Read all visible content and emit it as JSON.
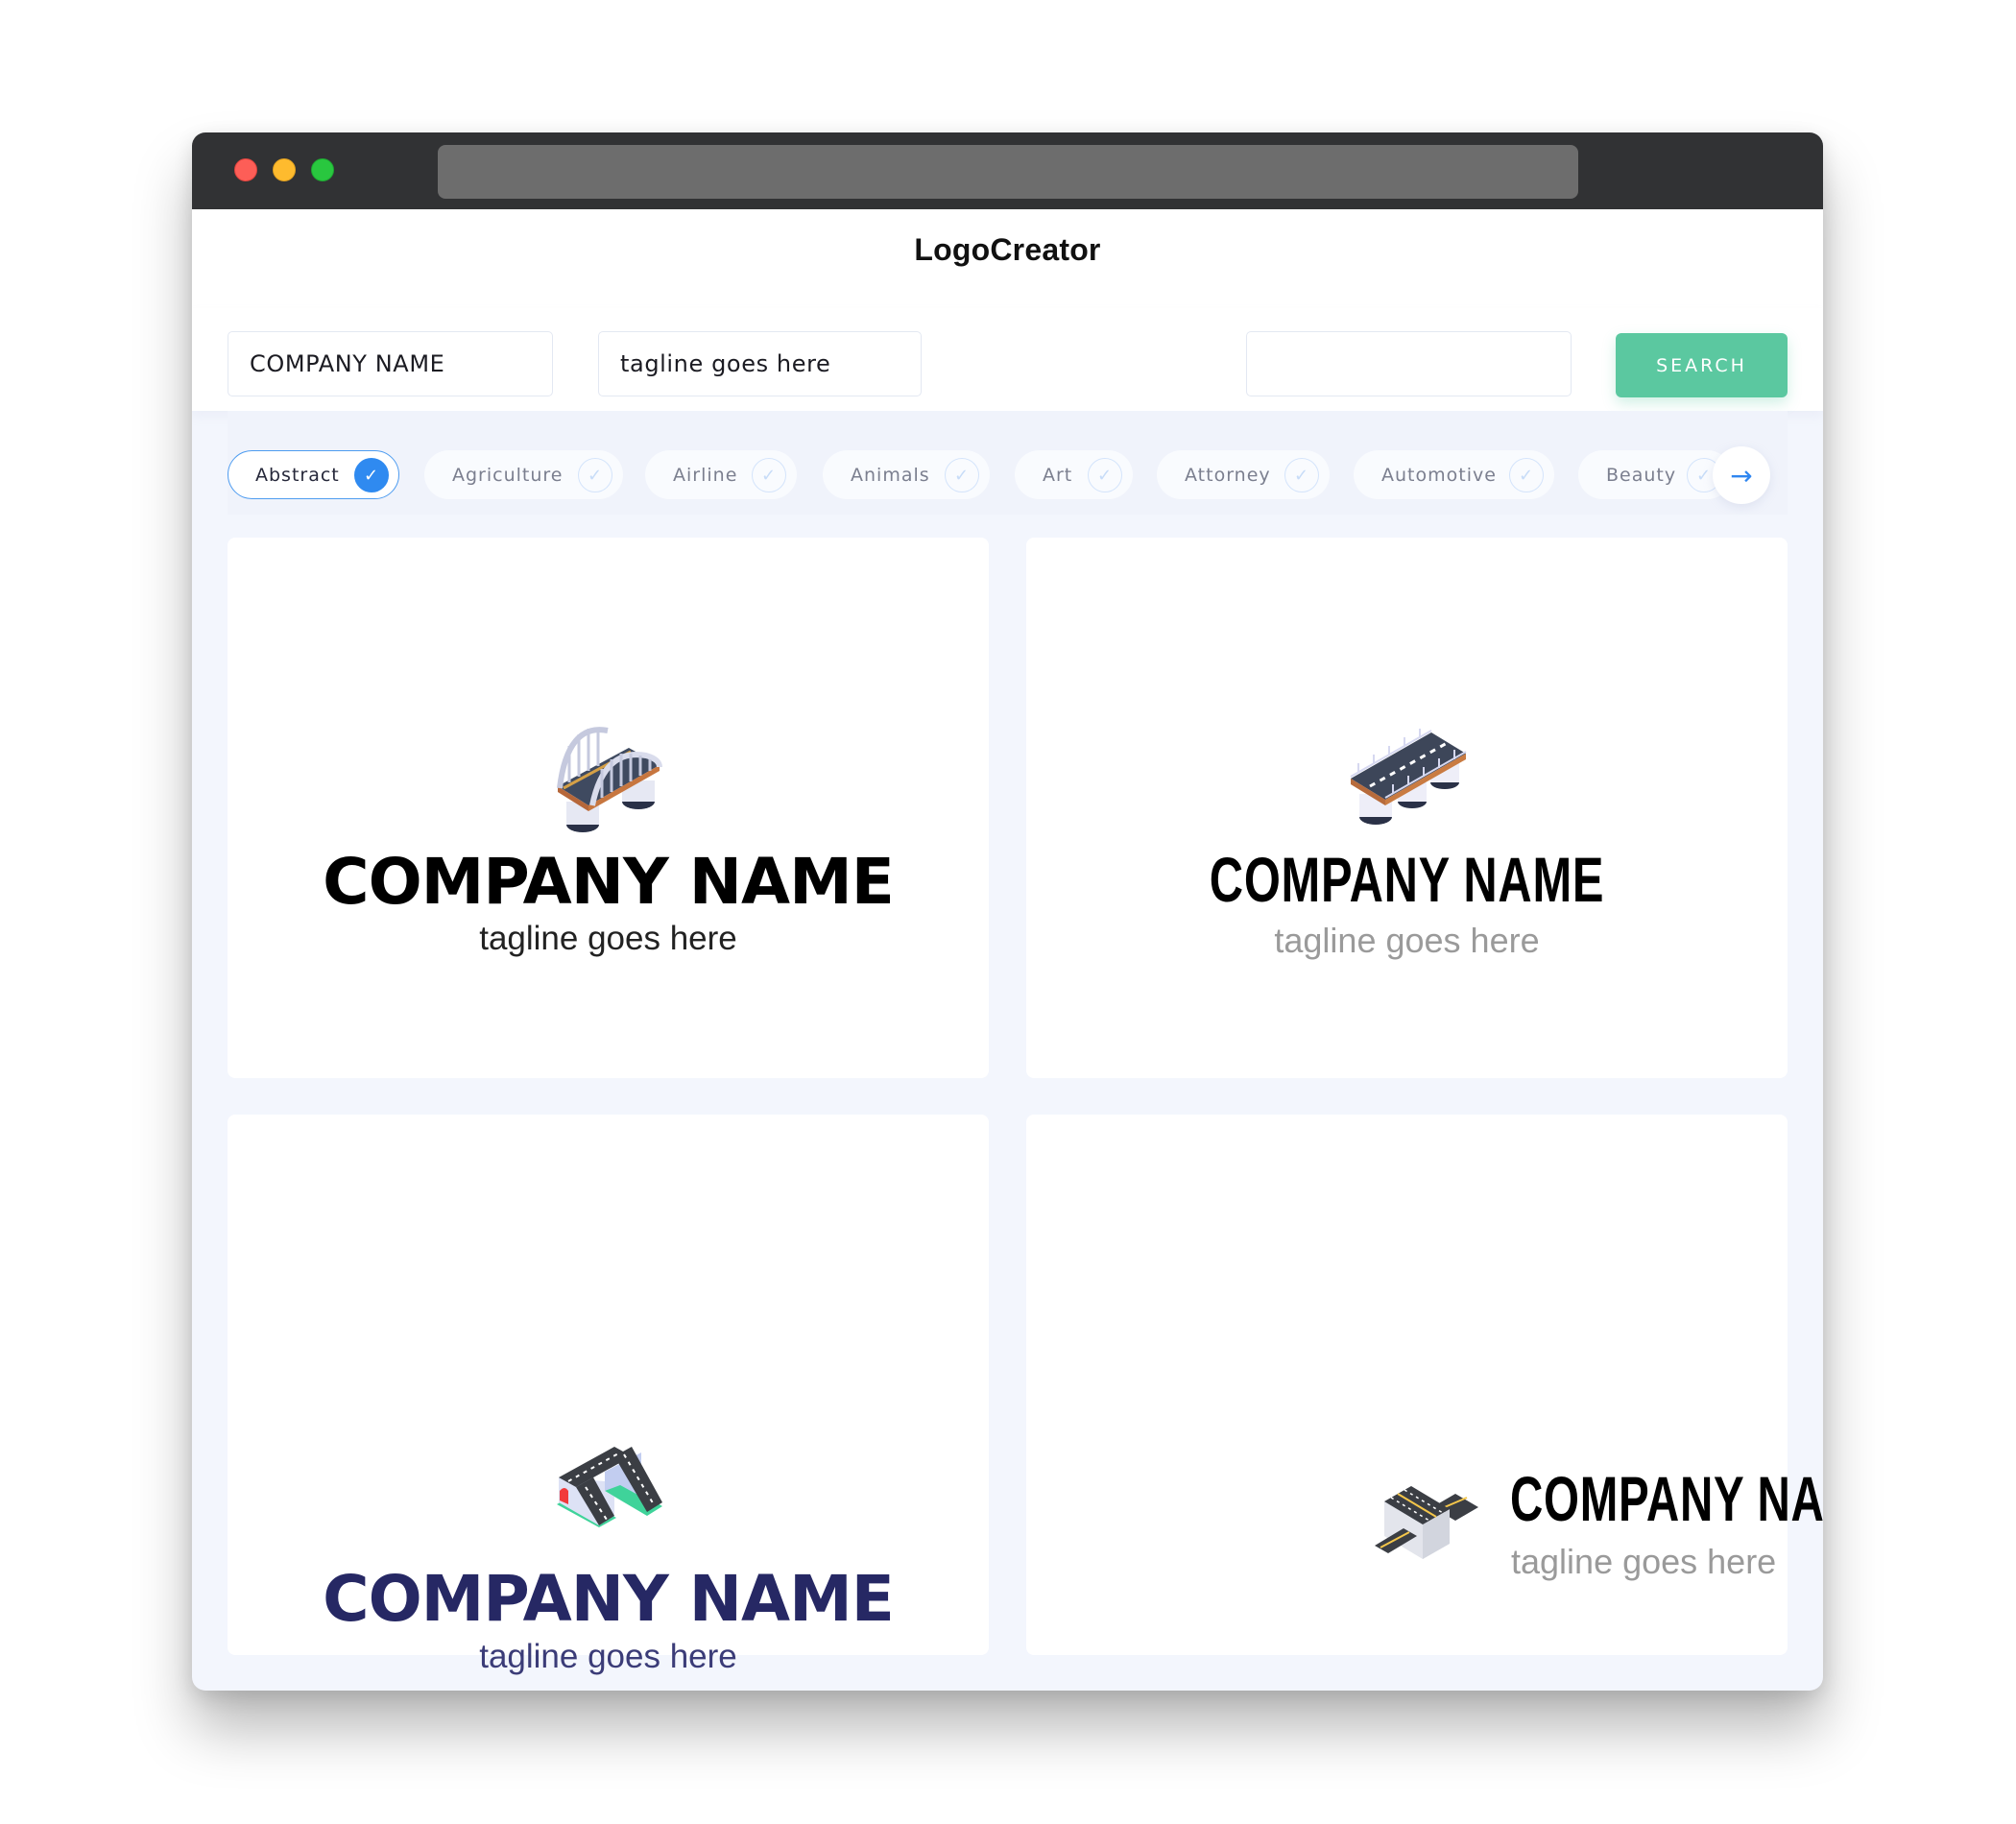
{
  "browser": {
    "controls": [
      "close",
      "minimize",
      "maximize"
    ]
  },
  "header": {
    "brand": "LogoCreator"
  },
  "search": {
    "company_value": "COMPANY NAME",
    "tagline_value": "tagline goes here",
    "extra_value": "",
    "button_label": "SEARCH"
  },
  "filters": {
    "items": [
      {
        "label": "Abstract",
        "selected": true
      },
      {
        "label": "Agriculture",
        "selected": false
      },
      {
        "label": "Airline",
        "selected": false
      },
      {
        "label": "Animals",
        "selected": false
      },
      {
        "label": "Art",
        "selected": false
      },
      {
        "label": "Attorney",
        "selected": false
      },
      {
        "label": "Automotive",
        "selected": false
      },
      {
        "label": "Beauty",
        "selected": false
      }
    ],
    "check_glyph": "✓",
    "next_glyph": "→"
  },
  "logos": [
    {
      "icon": "arch-bridge-icon",
      "name": "COMPANY NAME",
      "tagline": "tagline goes here",
      "name_color": "#000000",
      "tagline_color": "#222222"
    },
    {
      "icon": "road-bridge-icon",
      "name": "COMPANY NAME",
      "tagline": "tagline goes here",
      "name_color": "#000000",
      "tagline_color": "#9a9a9a"
    },
    {
      "icon": "overpass-tunnel-icon",
      "name": "COMPANY NAME",
      "tagline": "tagline goes here",
      "name_color": "#262864",
      "tagline_color": "#3b3c78"
    },
    {
      "icon": "highway-interchange-icon",
      "name": "COMPANY NAME",
      "tagline": "tagline goes here",
      "name_color": "#000000",
      "tagline_color": "#9a9a9a"
    }
  ],
  "colors": {
    "accent": "#2f8af0",
    "search_button": "#5bc8a0",
    "titlebar": "#313234",
    "page_bg": "#f3f6fd"
  }
}
